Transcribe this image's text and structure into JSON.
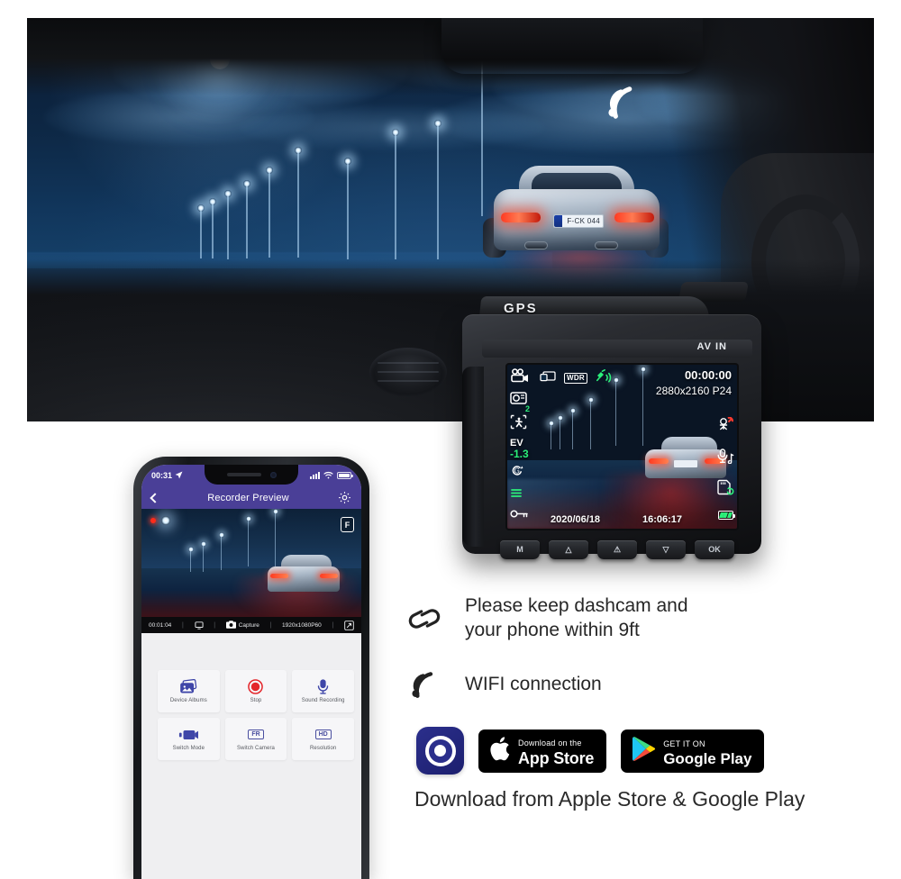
{
  "hero": {
    "scene_alt": "Night highway scene viewed through car windshield with silver sports car ahead",
    "license_plate": "F-CK 044",
    "wifi_icon": "wifi-signal-icon"
  },
  "dashcam": {
    "brand_label": "GPS",
    "input_label": "AV IN",
    "screen": {
      "timer": "00:00:00",
      "resolution": "2880x2160 P24",
      "date": "2020/06/18",
      "clock": "16:06:17",
      "ev_label": "EV",
      "ev_value": "-1.3",
      "wdr_label": "WDR",
      "loop_value": "2",
      "icons": [
        "video-camera-icon",
        "loop-recording-icon",
        "motion-detection-icon",
        "g-sensor-icon",
        "key-lock-icon",
        "screen-saver-icon",
        "wdr-icon",
        "gps-satellite-icon",
        "parking-monitor-icon",
        "microphone-audio-icon",
        "sd-card-icon",
        "battery-icon"
      ]
    },
    "buttons": [
      {
        "label": "M",
        "name": "menu-button"
      },
      {
        "label": "△",
        "name": "up-button"
      },
      {
        "label": "⚠",
        "name": "emergency-lock-button"
      },
      {
        "label": "▽",
        "name": "down-button"
      },
      {
        "label": "OK",
        "name": "ok-button"
      }
    ]
  },
  "phone": {
    "status_bar": {
      "time": "00:31",
      "location_icon": "location-arrow-icon",
      "signal_icon": "cellular-signal-icon",
      "wifi_icon": "wifi-icon",
      "battery_icon": "battery-icon"
    },
    "header": {
      "back_icon": "back-chevron-icon",
      "title": "Recorder Preview",
      "settings_icon": "gear-icon"
    },
    "preview": {
      "recording_indicator": "record-dot-icon",
      "front_camera_badge": "F",
      "expand_icon": "fullscreen-icon"
    },
    "toolbar": {
      "elapsed": "00:01:04",
      "monitor_icon": "monitor-icon",
      "capture_icon": "camera-icon",
      "capture_label": "Capture",
      "resolution": "1920x1080P60",
      "fullscreen_icon": "fullscreen-icon",
      "separator": "|"
    },
    "buttons": [
      {
        "label": "Device Albums",
        "icon": "photo-albums-icon",
        "name": "device-albums-button"
      },
      {
        "label": "Stop",
        "icon": "stop-record-icon",
        "name": "stop-button"
      },
      {
        "label": "Sound Recording",
        "icon": "microphone-icon",
        "name": "sound-recording-button"
      },
      {
        "label": "Switch Mode",
        "icon": "video-mode-icon",
        "name": "switch-mode-button"
      },
      {
        "label": "Switch Camera",
        "icon": "front-rear-camera-icon",
        "name": "switch-camera-button",
        "badge": "FR"
      },
      {
        "label": "Resolution",
        "icon": "hd-icon",
        "name": "resolution-button",
        "badge": "HD"
      }
    ]
  },
  "features": [
    {
      "icon": "chain-link-icon",
      "line1": "Please keep dashcam and",
      "line2": "your phone within 9ft"
    },
    {
      "icon": "wifi-signal-icon",
      "line1": "WIFI connection",
      "line2": ""
    }
  ],
  "stores": {
    "app_icon": "camera-app-icon",
    "apple": {
      "icon": "apple-logo-icon",
      "sub": "Download on the",
      "main": "App Store"
    },
    "google": {
      "icon": "google-play-triangle-icon",
      "sub": "GET IT ON",
      "main": "Google Play"
    },
    "caption": "Download from Apple Store & Google Play"
  },
  "colors": {
    "app_purple": "#4a3f97",
    "accent_green": "#2bf07a",
    "text_dark": "#272727",
    "badge_black": "#000000",
    "app_icon_blue": "#2b2f8c"
  }
}
